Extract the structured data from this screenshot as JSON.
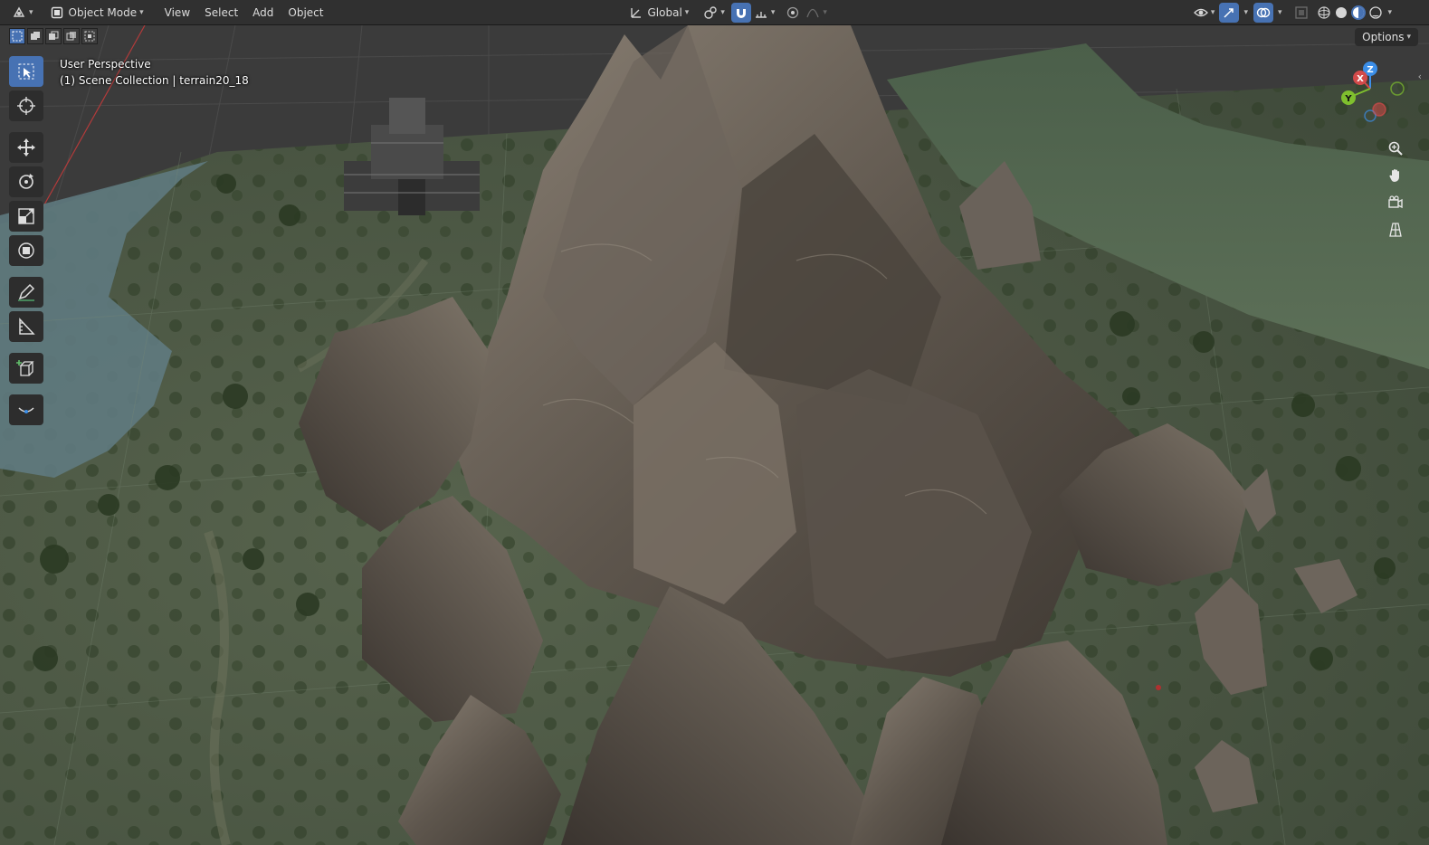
{
  "header": {
    "mode_label": "Object Mode",
    "menus": [
      "View",
      "Select",
      "Add",
      "Object"
    ],
    "transform_orientation": "Global"
  },
  "viewport": {
    "overlay_title": "User Perspective",
    "overlay_subtitle": "(1) Scene Collection | terrain20_18",
    "options_label": "Options"
  },
  "gizmo": {
    "x_label": "X",
    "y_label": "Y",
    "z_label": "Z",
    "colors": {
      "x": "#d34a4a",
      "y": "#7fbf2e",
      "z": "#3b8ee8"
    }
  },
  "toolbar": {
    "tools": [
      "select-box",
      "cursor",
      "move",
      "rotate",
      "scale",
      "transform",
      "annotate",
      "measure",
      "add-cube",
      "shrink-fatten"
    ],
    "active_tool": "select-box"
  },
  "colors": {
    "header_bg": "#303030",
    "accent": "#4772b3",
    "panel_bg": "#2d2d2d"
  }
}
